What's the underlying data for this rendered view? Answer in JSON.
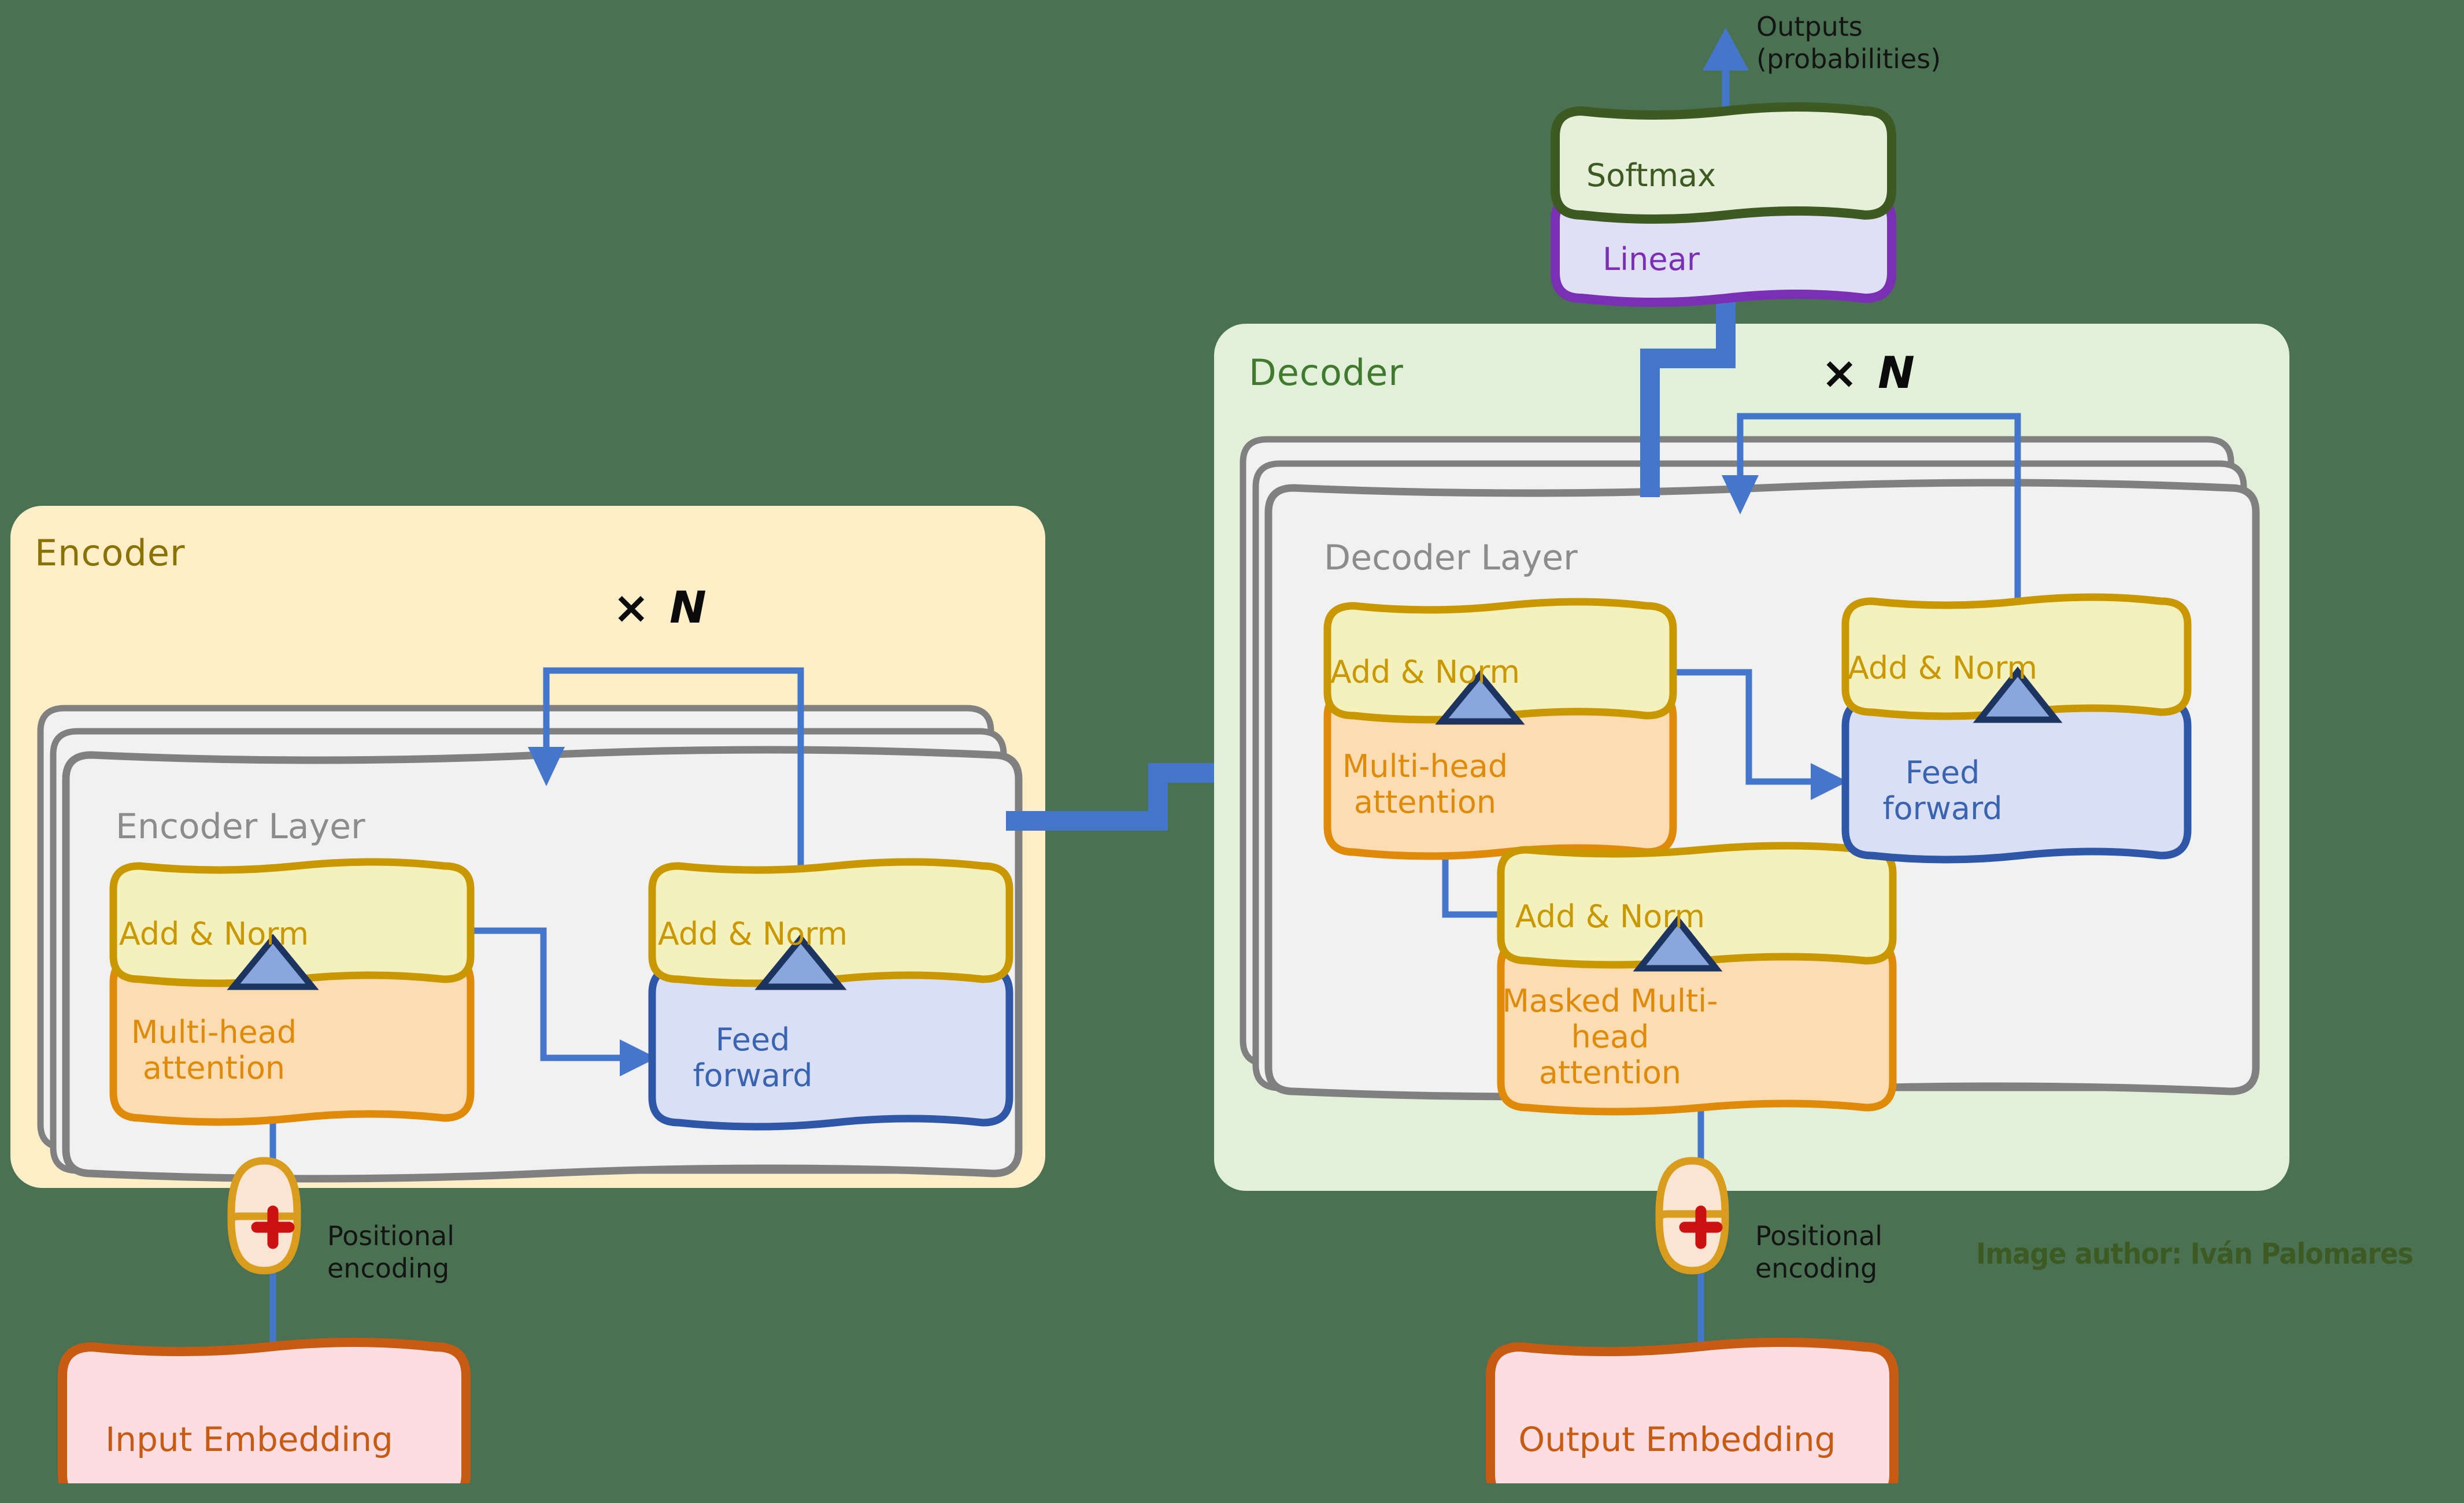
{
  "diagram": {
    "title": "Transformer encoder-decoder architecture",
    "background_color": "#4a7252",
    "credit": "Image author: Iván Palomares"
  },
  "colors": {
    "background": "#4a7252",
    "encoder_panel": "#fceec6",
    "decoder_panel": "#e2efd9",
    "layer_card": "#f1f1f1",
    "layer_card_border": "#808080",
    "add_norm_fill": "#f4f1bd",
    "add_norm_border": "#c99700",
    "add_norm_text": "#c99700",
    "attention_fill": "#fcdcb0",
    "attention_border": "#e08a0a",
    "attention_text": "#e08a0a",
    "feed_forward_fill": "#d9e0f5",
    "feed_forward_border": "#2e57a8",
    "feed_forward_text": "#3a63b0",
    "embedding_fill": "#fcdde1",
    "embedding_border": "#c75b12",
    "embedding_text": "#c75b12",
    "softmax_fill": "#e6f0d8",
    "softmax_border": "#3c5a22",
    "softmax_text": "#3c5a22",
    "linear_fill": "#e0e0f5",
    "linear_border": "#7b2fb5",
    "linear_text": "#7b2fb5",
    "arrow_blue": "#4477cc",
    "residual_triangle_fill": "#8aa7dd",
    "residual_triangle_border": "#1d3461",
    "plus_fill": "#fae4d3",
    "plus_border": "#d99c1c",
    "plus_sign": "#cc1111",
    "encoder_title_text": "#8a7207",
    "decoder_title_text": "#3f7a2f",
    "layer_title_text": "#8c8c8c"
  },
  "encoder": {
    "panel_title": "Encoder",
    "layer_title": "Encoder Layer",
    "repeat_label": "× N",
    "blocks": {
      "add_norm_1": "Add & Norm",
      "multi_head_attention": "Multi-head\nattention",
      "add_norm_2": "Add & Norm",
      "feed_forward": "Feed forward"
    },
    "positional_encoding_label": "Positional\nencoding",
    "plus_symbol": "+",
    "embedding": "Input Embedding"
  },
  "decoder": {
    "panel_title": "Decoder",
    "layer_title": "Decoder Layer",
    "repeat_label": "× N",
    "blocks": {
      "add_norm_cross": "Add & Norm",
      "multi_head_attention": "Multi-head\nattention",
      "add_norm_masked": "Add & Norm",
      "masked_multi_head_attention": "Masked Multi-head\nattention",
      "add_norm_ff": "Add & Norm",
      "feed_forward": "Feed forward"
    },
    "positional_encoding_label": "Positional\nencoding",
    "plus_symbol": "+",
    "embedding": "Output Embedding"
  },
  "head": {
    "linear": "Linear",
    "softmax": "Softmax",
    "outputs_label": "Outputs\n(probabilities)"
  }
}
